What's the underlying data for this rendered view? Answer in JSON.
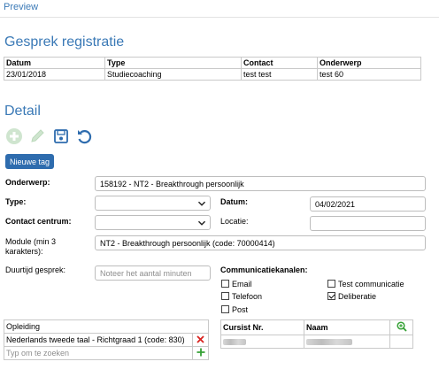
{
  "preview": {
    "label": "Preview"
  },
  "registratie": {
    "title": "Gesprek registratie",
    "columns": [
      "Datum",
      "Type",
      "Contact",
      "Onderwerp"
    ],
    "rows": [
      [
        "23/01/2018",
        "Studiecoaching",
        "test test",
        "test 60"
      ]
    ]
  },
  "detail": {
    "title": "Detail",
    "toolbar": {
      "add_icon": "plus-circle-icon",
      "edit_icon": "pencil-icon",
      "save_icon": "floppy-disk-icon",
      "undo_icon": "undo-icon",
      "new_tag_label": "Nieuwe tag"
    },
    "form": {
      "onderwerp_label": "Onderwerp:",
      "onderwerp_value": "158192 - NT2 - Breakthrough persoonlijk",
      "type_label": "Type:",
      "type_value": "",
      "datum_label": "Datum:",
      "datum_value": "04/02/2021",
      "contact_centrum_label": "Contact centrum:",
      "contact_centrum_value": "",
      "locatie_label": "Locatie:",
      "locatie_value": "",
      "module_label_line1": "Module (min 3",
      "module_label_line2": "karakters):",
      "module_value": "NT2 - Breakthrough persoonlijk (code: 70000414)",
      "duurtijd_label": "Duurtijd gesprek:",
      "duurtijd_placeholder": "Noteer het aantal minuten",
      "kanalen_label": "Communicatiekanalen:",
      "kanalen": [
        {
          "label": "Email",
          "checked": false
        },
        {
          "label": "Test communicatie",
          "checked": false
        },
        {
          "label": "Telefoon",
          "checked": false
        },
        {
          "label": "Deliberatie",
          "checked": true
        },
        {
          "label": "Post",
          "checked": false
        }
      ]
    },
    "opleiding": {
      "header": "Opleiding",
      "rows": [
        "Nederlands tweede taal - Richtgraad 1 (code: 830)"
      ],
      "search_placeholder": "Typ om te zoeken"
    },
    "cursisten": {
      "col_nr": "Cursist Nr.",
      "col_naam": "Naam"
    }
  },
  "colors": {
    "accent": "#3a79b6",
    "tag_button": "#2e6cae",
    "remove": "#d9231f",
    "add": "#35a135"
  }
}
